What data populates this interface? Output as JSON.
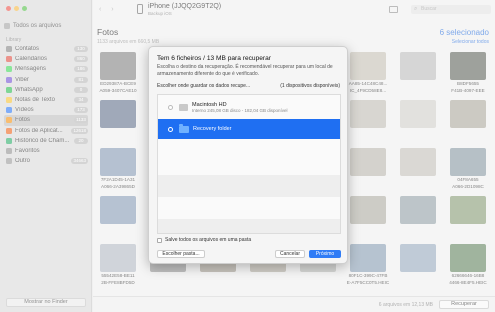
{
  "sidebar": {
    "all_files": "Todos os arquivos",
    "section": "Library",
    "items": [
      {
        "label": "Contatos",
        "count": "130",
        "color": "#8c8c8c"
      },
      {
        "label": "Calendários",
        "count": "860",
        "color": "#e05a4f"
      },
      {
        "label": "Mensagens",
        "count": "186",
        "color": "#4cd964"
      },
      {
        "label": "Viber",
        "count": "81",
        "color": "#7b5cd6"
      },
      {
        "label": "WhatsApp",
        "count": "0",
        "color": "#39c15c"
      },
      {
        "label": "Notas de Texto",
        "count": "34",
        "color": "#f4c542"
      },
      {
        "label": "Vídeos",
        "count": "173",
        "color": "#3b82f6"
      },
      {
        "label": "Fotos",
        "count": "1133",
        "color": "#f59a23"
      },
      {
        "label": "Fotos de Aplicat...",
        "count": "12618",
        "color": "#ef6f2c"
      },
      {
        "label": "Histórico de Cham...",
        "count": "20",
        "color": "#3bb273"
      },
      {
        "label": "Favoritos",
        "count": "",
        "color": "#999999"
      },
      {
        "label": "Outro",
        "count": "34663",
        "color": "#a0a0a0"
      }
    ],
    "finder_button": "Mostrar no Finder"
  },
  "header": {
    "device": "iPhone (JJQQ2G9T2Q)",
    "backup": "Backup iOS",
    "search_placeholder": "Buscar"
  },
  "section": {
    "title": "Fotos",
    "subtitle": "1133 arquivos em 660,5 MB",
    "selected": "6 selecionado",
    "select_all": "Selecionar todos"
  },
  "tiles": [
    {
      "cap1": "ED29387A-BCE9",
      "cap2": "A059-3407CAE10",
      "color": "#8b8b8b",
      "selected": false
    },
    {
      "cap1": "",
      "cap2": "",
      "color": "#b9b4aa",
      "selected": false
    },
    {
      "cap1": "",
      "cap2": "",
      "color": "#9ba4ab",
      "selected": false
    },
    {
      "cap1": "",
      "cap2": "",
      "color": "#7f8a6e",
      "selected": false
    },
    {
      "cap1": "",
      "cap2": "",
      "color": "#a9a79c",
      "selected": false
    },
    {
      "cap1": "AA85-14C48C48...",
      "cap2": "IC_4F9CD58E8...",
      "color": "#c8c3b8",
      "selected": false
    },
    {
      "cap1": "",
      "cap2": "",
      "color": "#c0c0c0",
      "selected": false
    },
    {
      "cap1": "B8DF5655",
      "cap2": "F41B-4097-EEE",
      "color": "#6b6f68",
      "selected": false
    },
    {
      "cap1": "",
      "cap2": "",
      "color": "#6d7c94",
      "selected": false
    },
    {
      "cap1": "",
      "cap2": "",
      "color": "#8e8f88",
      "selected": false
    },
    {
      "cap1": "",
      "cap2": "",
      "color": "#a38c6a",
      "selected": false
    },
    {
      "cap1": "",
      "cap2": "",
      "color": "#9aa39a",
      "selected": false
    },
    {
      "cap1": "",
      "cap2": "",
      "color": "#b5b0a4",
      "selected": false
    },
    {
      "cap1": "",
      "cap2": "",
      "color": "#c4c1b9",
      "selected": false
    },
    {
      "cap1": "",
      "cap2": "",
      "color": "#d3d1cc",
      "selected": false
    },
    {
      "cap1": "",
      "cap2": "",
      "color": "#b1aea4",
      "selected": false
    },
    {
      "cap1": "7F2A1D45-1A31",
      "cap2": "A066-2A39865D",
      "color": "#8ea0b8",
      "selected": false
    },
    {
      "cap1": "",
      "cap2": "",
      "color": "#9a9a9a",
      "selected": false
    },
    {
      "cap1": "",
      "cap2": "",
      "color": "#c0bdb4",
      "selected": false
    },
    {
      "cap1": "",
      "cap2": "",
      "color": "#7e8890",
      "selected": false
    },
    {
      "cap1": "",
      "cap2": "",
      "color": "#adb1b3",
      "selected": false
    },
    {
      "cap1": "",
      "cap2": "",
      "color": "#bdbab2",
      "selected": false
    },
    {
      "cap1": "",
      "cap2": "",
      "color": "#c6c3bd",
      "selected": false
    },
    {
      "cap1": "04F8A655",
      "cap2": "A066-2D1098C",
      "color": "#8f9fa8",
      "selected": false
    },
    {
      "cap1": "",
      "cap2": "",
      "color": "#90a2bb",
      "selected": false
    },
    {
      "cap1": "",
      "cap2": "",
      "color": "#8c9783",
      "selected": false
    },
    {
      "cap1": "",
      "cap2": "",
      "color": "#7e8a75",
      "selected": false
    },
    {
      "cap1": "",
      "cap2": "",
      "color": "#99a49d",
      "selected": false
    },
    {
      "cap1": "",
      "cap2": "",
      "color": "#a8b0a0",
      "selected": false
    },
    {
      "cap1": "",
      "cap2": "",
      "color": "#b3b1a8",
      "selected": false
    },
    {
      "cap1": "",
      "cap2": "",
      "color": "#9aa7ad",
      "selected": false
    },
    {
      "cap1": "",
      "cap2": "",
      "color": "#8fa17f",
      "selected": false
    },
    {
      "cap1": "55542E58-BE11",
      "cap2": "2B-FFE8BFD5D",
      "color": "#b7bdc6",
      "selected": false
    },
    {
      "cap1": "",
      "cap2": "",
      "color": "#9d9d9d",
      "selected": false
    },
    {
      "cap1": "",
      "cap2": "",
      "color": "#a9a398",
      "selected": false
    },
    {
      "cap1": "",
      "cap2": "",
      "color": "#b7b3a8",
      "selected": false
    },
    {
      "cap1": "",
      "cap2": "",
      "color": "#bfc0bd",
      "selected": false
    },
    {
      "cap1": "80F1C-399C-47FB",
      "cap2": "E-A7F5CC0T5.HEIC",
      "color": "#8fa3b7",
      "selected": false
    },
    {
      "cap1": "",
      "cap2": "",
      "color": "#9fb0c2",
      "selected": false
    },
    {
      "cap1": "62666646-16B8",
      "cap2": "4466-8E4F5.HEIC",
      "color": "#6e8d6a",
      "selected": false
    }
  ],
  "footer": {
    "status": "6 arquivos em 12,13 MB",
    "recover": "Recuperar"
  },
  "dialog": {
    "title": "Tem 6 ficheiros / 13 MB para recuperar",
    "description": "Escolha o destino da recuperação. É recomendável recuperar para um local de armazenamento diferente do que é verificado.",
    "choose_label": "Escolher onde guardar os dados recupe...",
    "available": "(1 dispositivos disponíveis)",
    "locations": [
      {
        "name": "Macintosh HD",
        "detail": "Interno 245,08 GB disco - 182,04 GB disponível",
        "type": "disk",
        "selected": false
      },
      {
        "name": "Recovery folder",
        "detail": "",
        "type": "folder",
        "selected": true
      }
    ],
    "save_all": "Salve todos os arquivos em uma pasta",
    "choose_folder": "Escolher pasta...",
    "cancel": "Cancelar",
    "next": "Próximo"
  }
}
